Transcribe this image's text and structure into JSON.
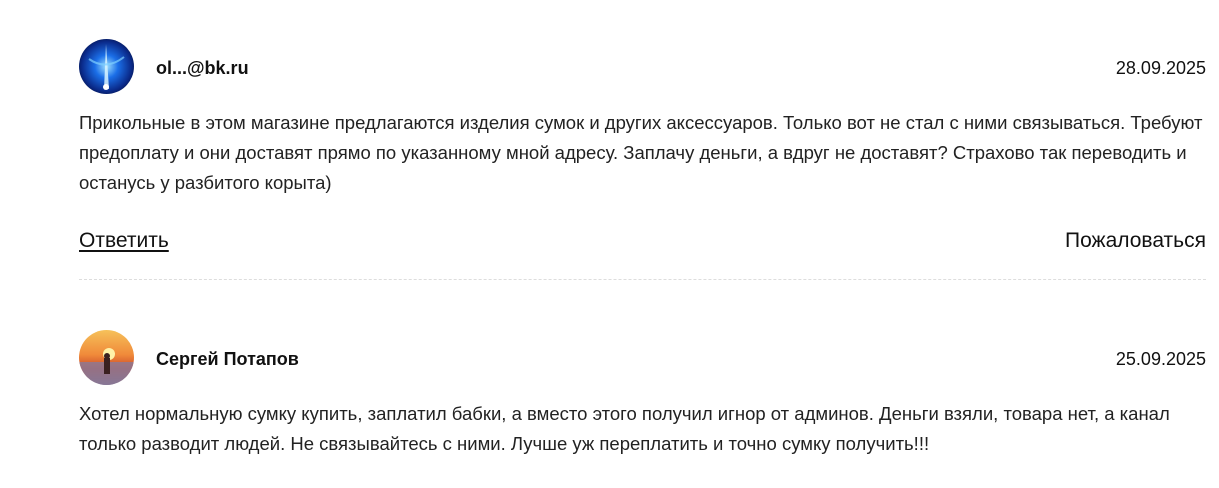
{
  "reviews": [
    {
      "author": "ol...@bk.ru",
      "date": "28.09.2025",
      "text": "Прикольные в этом магазине предлагаются изделия сумок и других аксессуаров. Только вот не стал с ними связываться. Требуют предоплату и они доставят прямо по указанному мной адресу. Заплачу деньги, а вдруг не доставят? Страхово так переводить и останусь у разбитого корыта)",
      "reply_label": "Ответить",
      "report_label": "Пожаловаться",
      "avatar_icon": "blue-light-avatar"
    },
    {
      "author": "Сергей Потапов",
      "date": "25.09.2025",
      "text": "Хотел нормальную сумку купить, заплатил бабки, а вместо этого получил игнор от админов. Деньги взяли, товара нет, а канал только разводит людей. Не связывайтесь с ними. Лучше уж переплатить и точно сумку получить!!!",
      "avatar_icon": "sunset-avatar"
    }
  ],
  "colors": {
    "text": "#111111",
    "divider": "#dddddd"
  }
}
